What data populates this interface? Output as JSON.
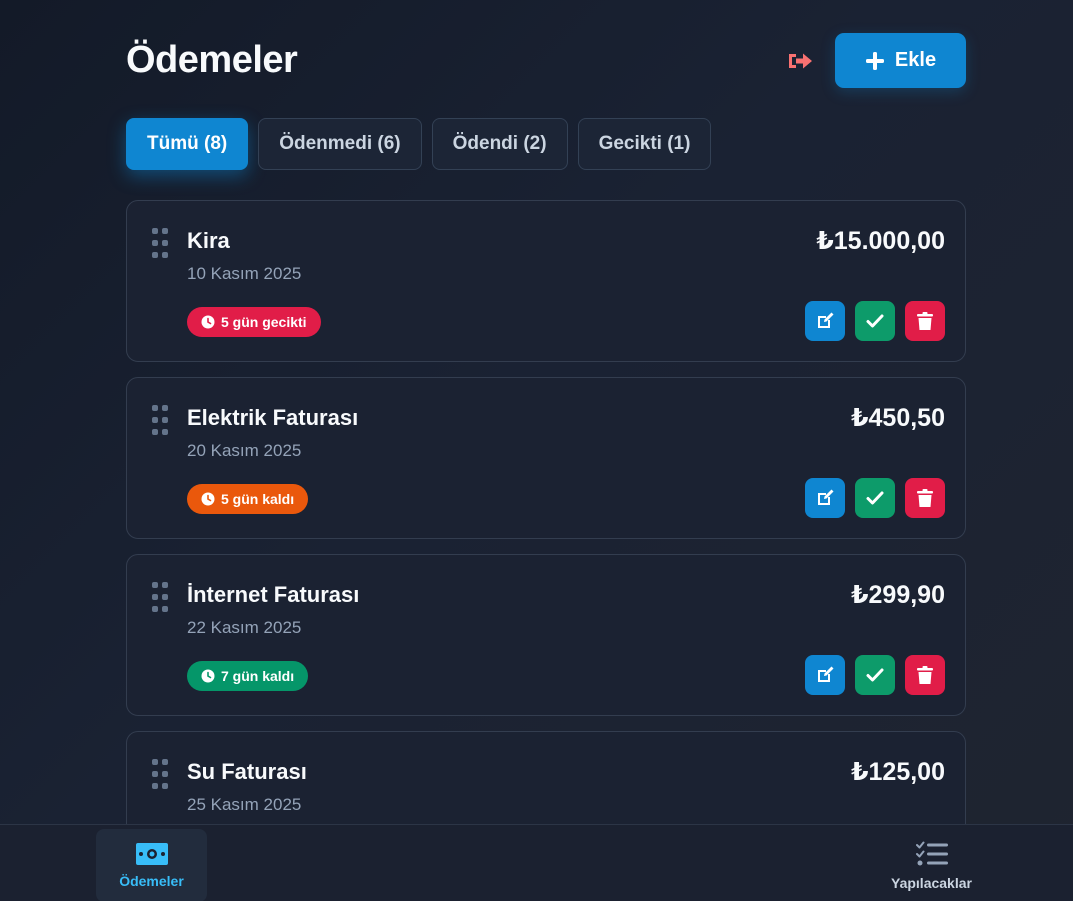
{
  "header": {
    "title": "Ödemeler",
    "add_label": "Ekle"
  },
  "tabs": [
    {
      "label": "Tümü (8)",
      "active": true
    },
    {
      "label": "Ödenmedi (6)",
      "active": false
    },
    {
      "label": "Ödendi (2)",
      "active": false
    },
    {
      "label": "Gecikti (1)",
      "active": false
    }
  ],
  "payments": [
    {
      "title": "Kira",
      "date": "10 Kasım 2025",
      "amount": "₺15.000,00",
      "badge": "5 gün gecikti",
      "badge_color": "#e11d48"
    },
    {
      "title": "Elektrik Faturası",
      "date": "20 Kasım 2025",
      "amount": "₺450,50",
      "badge": "5 gün kaldı",
      "badge_color": "#ea580c"
    },
    {
      "title": "İnternet Faturası",
      "date": "22 Kasım 2025",
      "amount": "₺299,90",
      "badge": "7 gün kaldı",
      "badge_color": "#059669"
    },
    {
      "title": "Su Faturası",
      "date": "25 Kasım 2025",
      "amount": "₺125,00",
      "badge": "",
      "badge_color": ""
    }
  ],
  "nav": {
    "payments_label": "Ödemeler",
    "todos_label": "Yapılacaklar"
  },
  "colors": {
    "accent": "#0f86d1",
    "success": "#0d9b6a",
    "danger": "#e11d48",
    "logout": "#f87171",
    "nav_active": "#38bdf8",
    "nav_inactive": "#cbd5e1"
  }
}
